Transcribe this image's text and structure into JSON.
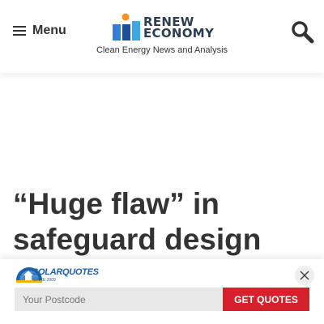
{
  "header": {
    "menu_label": "Menu",
    "logo_line1": "RENEW",
    "logo_line2": "ECONOMY",
    "tagline": "Clean Energy News and Analysis",
    "icons": {
      "menu": "hamburger-icon",
      "search": "search-icon"
    }
  },
  "article": {
    "title": "“Huge flaw” in safeguard design"
  },
  "promo": {
    "brand": "SOLARQUOTES",
    "since": "SINCE 2009",
    "postcode_placeholder": "Your Postcode",
    "button_label": "GET QUOTES",
    "icons": {
      "logo": "solarquotes-logo",
      "close": "close-icon"
    },
    "colors": {
      "button": "#d6202c",
      "brand": "#1d5fa8"
    }
  }
}
